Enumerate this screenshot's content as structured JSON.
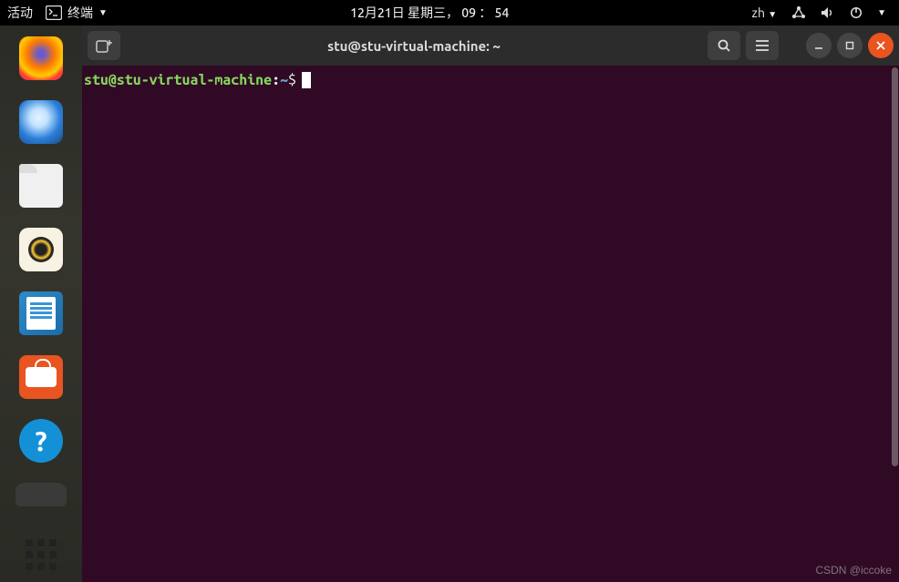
{
  "topbar": {
    "activities": "活动",
    "app_label": "终端",
    "datetime": "12月21日 星期三， 09 ： 54",
    "ime": "zh"
  },
  "dock": {
    "items": [
      {
        "name": "firefox"
      },
      {
        "name": "thunderbird"
      },
      {
        "name": "files"
      },
      {
        "name": "rhythmbox"
      },
      {
        "name": "libreoffice-writer"
      },
      {
        "name": "ubuntu-software"
      },
      {
        "name": "help"
      },
      {
        "name": "trash"
      },
      {
        "name": "show-applications"
      }
    ]
  },
  "window": {
    "title": "stu@stu-virtual-machine: ~",
    "prompt": {
      "user_host": "stu@stu-virtual-machine",
      "separator": ":",
      "path": "~",
      "symbol": "$"
    }
  },
  "watermark": "CSDN @iccoke"
}
